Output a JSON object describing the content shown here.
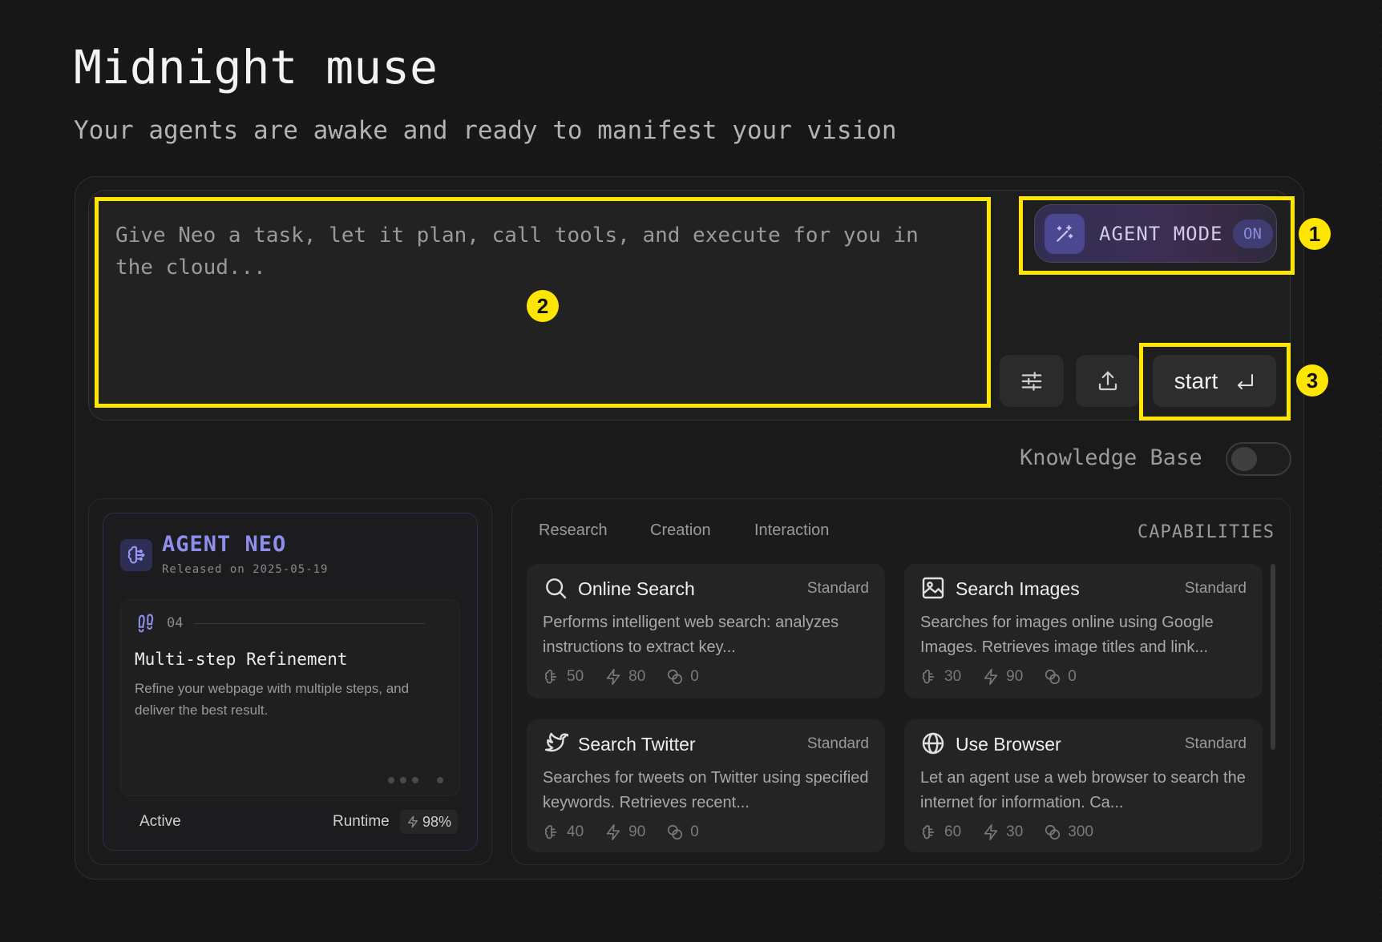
{
  "header": {
    "title": "Midnight muse",
    "subtitle": "Your agents are awake and ready to manifest your vision"
  },
  "composer": {
    "placeholder": "Give Neo a task, let it plan, call tools, and execute for you in the cloud...",
    "agent_mode_label": "AGENT MODE",
    "agent_mode_state": "ON",
    "start_label": "start"
  },
  "knowledge_base": {
    "label": "Knowledge Base",
    "enabled": false
  },
  "annotations": [
    "1",
    "2",
    "3"
  ],
  "agent": {
    "name": "AGENT NEO",
    "release": "Released on 2025-05-19",
    "step_number": "04",
    "step_title": "Multi-step Refinement",
    "step_desc": "Refine your webpage with multiple steps, and deliver the best result.",
    "status": "Active",
    "runtime_label": "Runtime",
    "runtime_value": "98%"
  },
  "capabilities": {
    "heading": "CAPABILITIES",
    "tabs": [
      "Research",
      "Creation",
      "Interaction"
    ],
    "items": [
      {
        "title": "Online Search",
        "tier": "Standard",
        "icon": "search-icon",
        "desc": "Performs intelligent web search: analyzes instructions to extract key...",
        "stats": [
          "50",
          "80",
          "0"
        ]
      },
      {
        "title": "Search Images",
        "tier": "Standard",
        "icon": "image-icon",
        "desc": "Searches for images online using Google Images. Retrieves image titles and link...",
        "stats": [
          "30",
          "90",
          "0"
        ]
      },
      {
        "title": "Search Twitter",
        "tier": "Standard",
        "icon": "twitter-icon",
        "desc": "Searches for tweets on Twitter using specified keywords. Retrieves recent...",
        "stats": [
          "40",
          "90",
          "0"
        ]
      },
      {
        "title": "Use Browser",
        "tier": "Standard",
        "icon": "globe-icon",
        "desc": "Let an agent use a web browser to search the internet for information. Ca...",
        "stats": [
          "60",
          "30",
          "300"
        ]
      }
    ]
  },
  "colors": {
    "background": "#171717",
    "accent": "#8e8ef0",
    "highlight": "#ffe600"
  }
}
